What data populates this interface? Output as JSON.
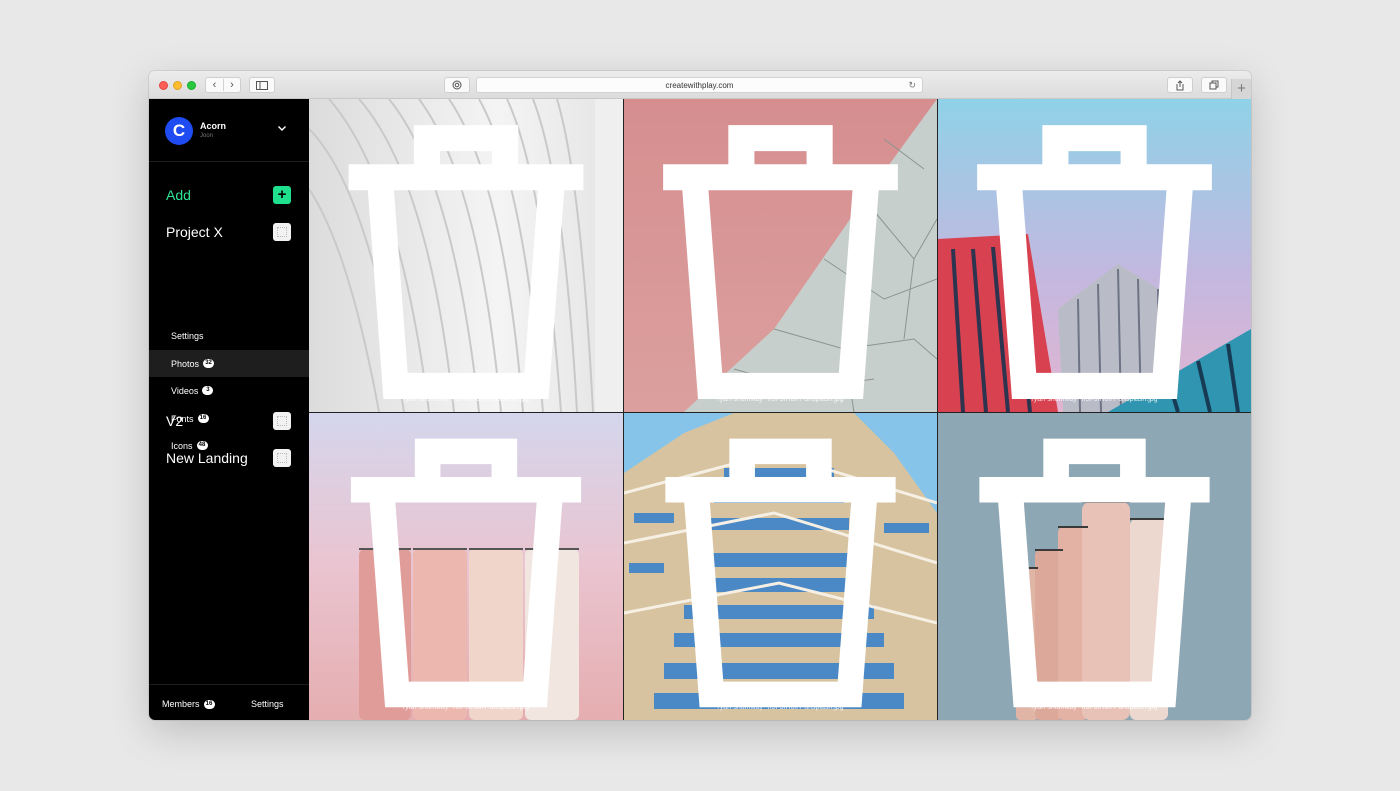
{
  "browser": {
    "url": "createwithplay.com",
    "nav_back": "‹",
    "nav_forward": "›",
    "new_tab": "+"
  },
  "account": {
    "avatar_letter": "C",
    "name": "Acorn",
    "user": "Joon"
  },
  "sidebar": {
    "add_label": "Add",
    "add_icon": "+",
    "projects": [
      {
        "label": "Project X"
      },
      {
        "label": "V2"
      },
      {
        "label": "New Landing"
      }
    ],
    "project_x_items": [
      {
        "label": "Settings",
        "badge": ""
      },
      {
        "label": "Photos",
        "badge": "32"
      },
      {
        "label": "Videos",
        "badge": "3"
      },
      {
        "label": "Fonts",
        "badge": "16"
      },
      {
        "label": "Icons",
        "badge": "48"
      }
    ],
    "active_item": "Photos"
  },
  "footer": {
    "members_label": "Members",
    "members_count": "16",
    "settings_label": "Settings"
  },
  "photos": [
    {
      "filename": "ryan-shumway--n5F3fH0lIY-unsplash.jpg",
      "icon": "trash-icon"
    },
    {
      "filename": "ryan-shumway--n5F3fH0lIY-unsplash.jpg",
      "icon": "trash-icon"
    },
    {
      "filename": "ryan-shumway--n5F3fH0lIY-unsplash.jpg",
      "icon": "trash-icon"
    },
    {
      "filename": "ryan-shumway--n5F3fH0lIY-unsplash.jpg",
      "icon": "trash-icon"
    },
    {
      "filename": "ryan-shumway--n5F3fH0lIY-unsplash.jpg",
      "icon": "trash-icon"
    },
    {
      "filename": "ryan-shumway--n5F3fH0lIY-unsplash.jpg",
      "icon": "trash-icon"
    }
  ],
  "colors": {
    "accent_green": "#1fe08c",
    "avatar_blue": "#1f4cf2",
    "sidebar_bg": "#000000"
  }
}
